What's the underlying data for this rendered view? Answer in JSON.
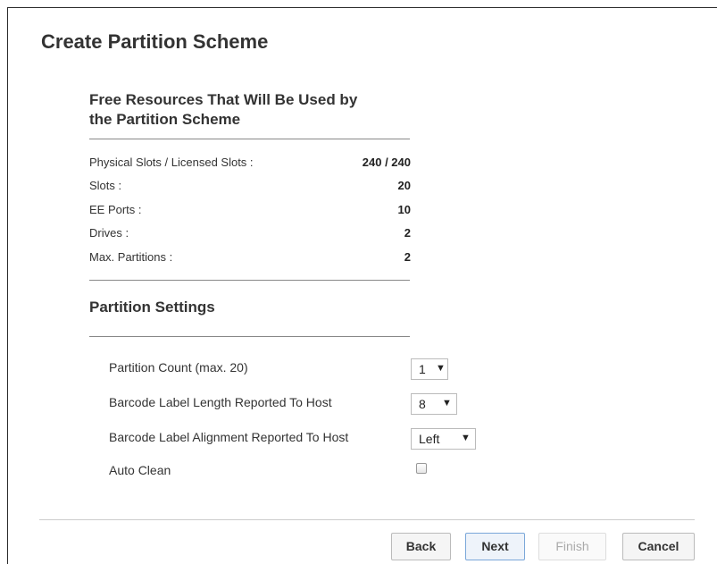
{
  "page": {
    "title": "Create Partition Scheme"
  },
  "resources": {
    "title": "Free Resources That Will Be Used by the Partition Scheme",
    "title_line1": "Free Resources That Will Be Used by",
    "title_line2": "the Partition Scheme",
    "rows": [
      {
        "label": "Physical Slots / Licensed Slots :",
        "value": "240 / 240"
      },
      {
        "label": "Slots :",
        "value": "20"
      },
      {
        "label": "EE Ports :",
        "value": "10"
      },
      {
        "label": "Drives :",
        "value": "2"
      },
      {
        "label": "Max. Partitions :",
        "value": "2"
      }
    ]
  },
  "settings": {
    "title": "Partition Settings",
    "partition_count": {
      "label": "Partition Count (max. 20)",
      "value": "1"
    },
    "barcode_length": {
      "label": "Barcode Label Length Reported To Host",
      "value": "8"
    },
    "barcode_alignment": {
      "label": "Barcode Label Alignment Reported To Host",
      "value": "Left"
    },
    "auto_clean": {
      "label": "Auto Clean",
      "checked": false
    }
  },
  "buttons": {
    "back": "Back",
    "next": "Next",
    "finish": "Finish",
    "cancel": "Cancel"
  },
  "icons": {
    "dropdown": "▼"
  }
}
